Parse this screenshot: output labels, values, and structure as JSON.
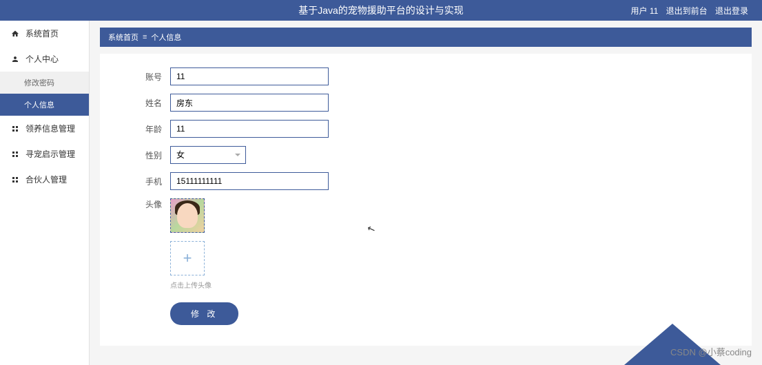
{
  "header": {
    "title": "基于Java的宠物援助平台的设计与实现",
    "user_label": "用户 11",
    "exit_front": "退出到前台",
    "logout": "退出登录"
  },
  "sidebar": {
    "items": [
      {
        "label": "系统首页",
        "icon": "home"
      },
      {
        "label": "个人中心",
        "icon": "person"
      },
      {
        "label": "领养信息管理",
        "icon": "grid"
      },
      {
        "label": "寻宠启示管理",
        "icon": "grid"
      },
      {
        "label": "合伙人管理",
        "icon": "grid"
      }
    ],
    "sub": [
      {
        "label": "修改密码"
      },
      {
        "label": "个人信息"
      }
    ]
  },
  "breadcrumb": {
    "root": "系统首页",
    "current": "个人信息"
  },
  "form": {
    "account_label": "账号",
    "account_value": "11",
    "name_label": "姓名",
    "name_value": "房东",
    "age_label": "年龄",
    "age_value": "11",
    "gender_label": "性别",
    "gender_value": "女",
    "phone_label": "手机",
    "phone_value": "15111111111",
    "avatar_label": "头像",
    "upload_hint": "点击上传头像",
    "submit_label": "修 改"
  },
  "watermark": "CSDN @小蔡coding"
}
